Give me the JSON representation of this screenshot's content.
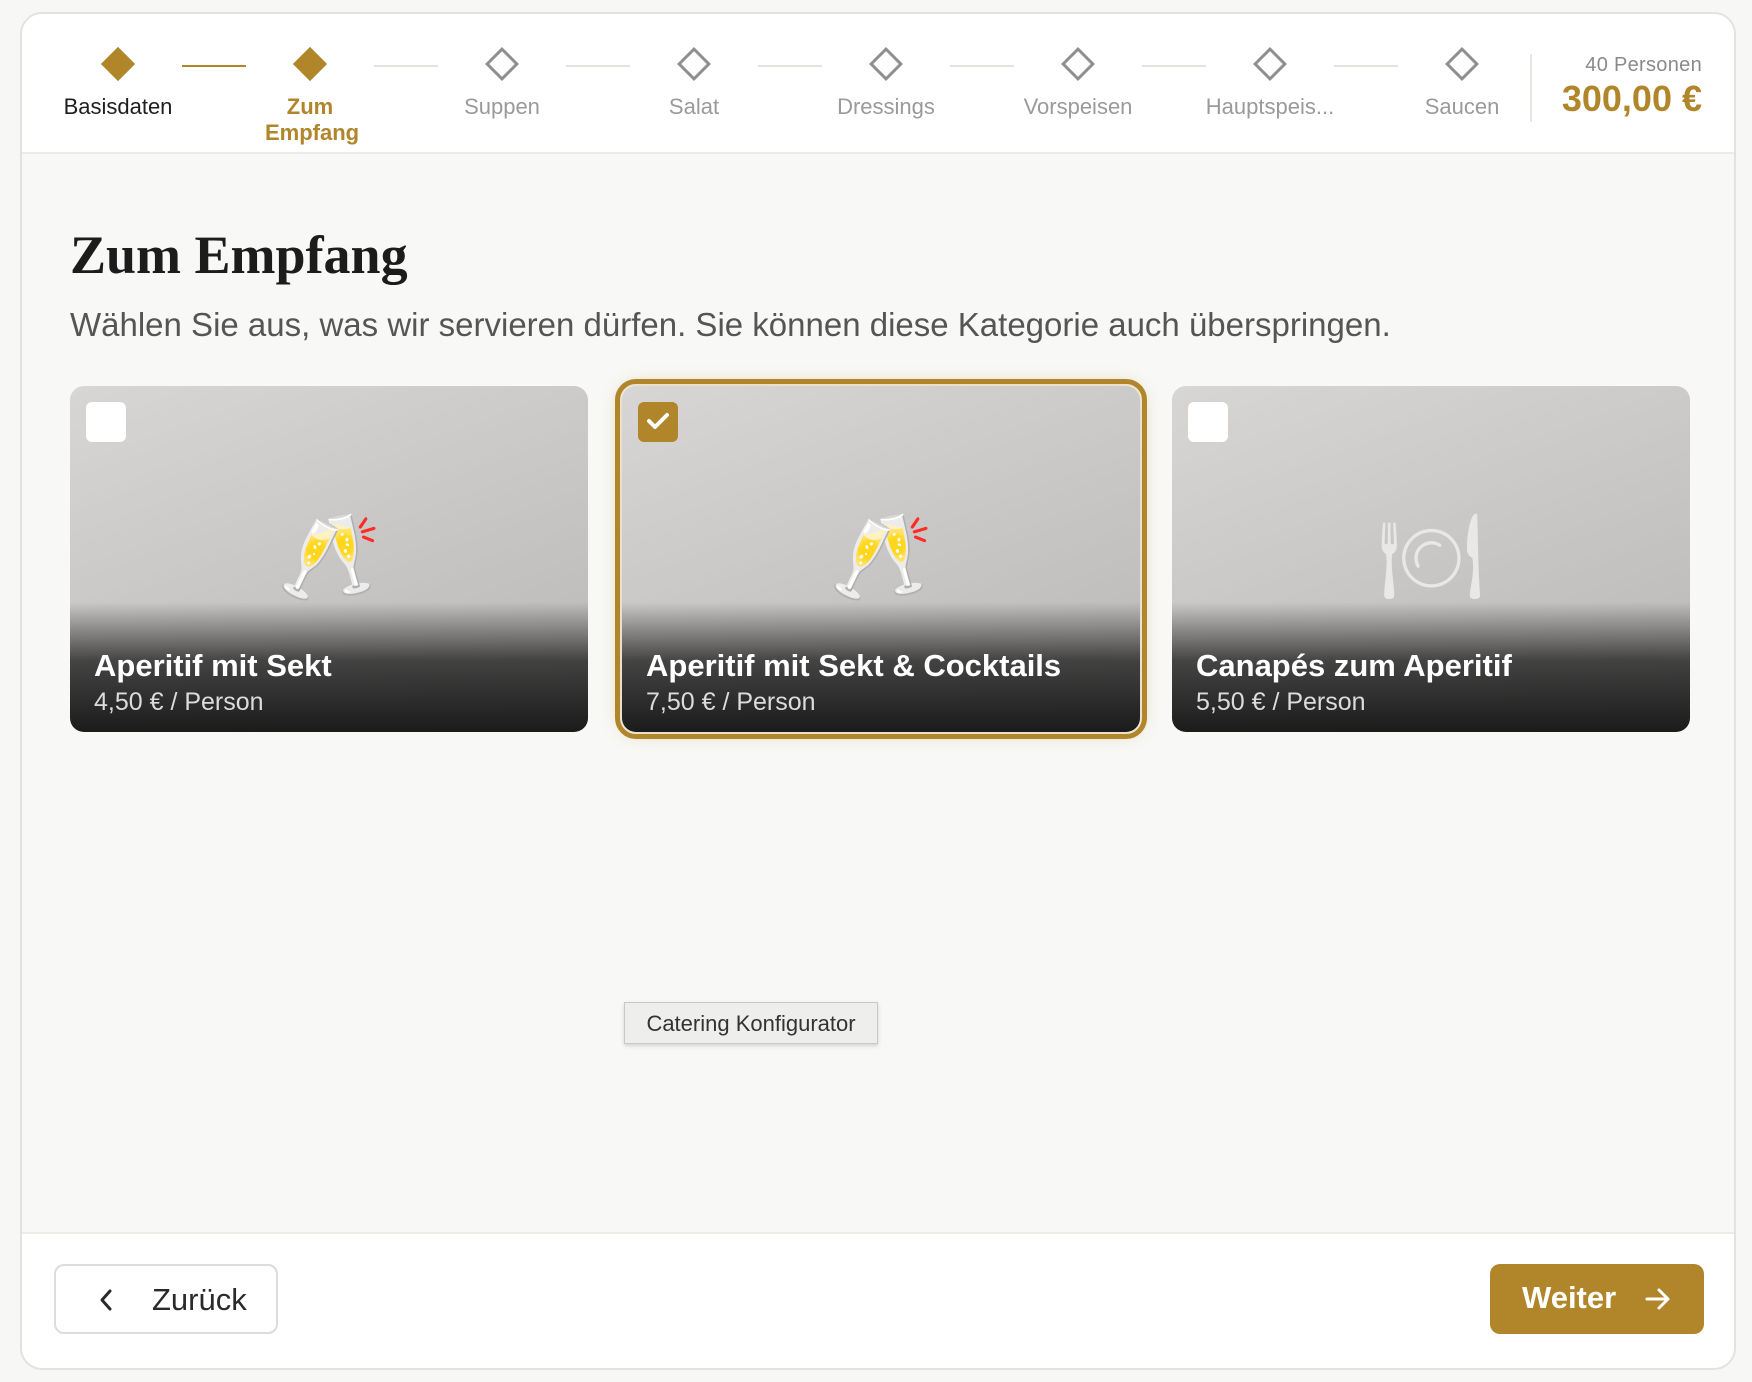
{
  "stepper": {
    "steps": [
      {
        "label": "Basisdaten",
        "state": "done"
      },
      {
        "label": "Zum Empfang",
        "state": "active"
      },
      {
        "label": "Suppen",
        "state": "pending"
      },
      {
        "label": "Salat",
        "state": "pending"
      },
      {
        "label": "Dressings",
        "state": "pending"
      },
      {
        "label": "Vorspeisen",
        "state": "pending"
      },
      {
        "label": "Hauptspeis...",
        "state": "pending"
      },
      {
        "label": "Saucen",
        "state": "pending"
      }
    ]
  },
  "summary": {
    "persons": "40 Personen",
    "total": "300,00 €"
  },
  "main": {
    "title": "Zum Empfang",
    "subtitle": "Wählen Sie aus, was wir servieren dürfen. Sie können diese Kategorie auch überspringen."
  },
  "options": [
    {
      "name": "Aperitif mit Sekt",
      "price": "4,50 € / Person",
      "selected": false,
      "icon": "champagne-glasses-icon"
    },
    {
      "name": "Aperitif mit Sekt & Cocktails",
      "price": "7,50 € / Person",
      "selected": true,
      "icon": "champagne-glasses-icon"
    },
    {
      "name": "Canapés zum Aperitif",
      "price": "5,50 € / Person",
      "selected": false,
      "icon": "plate-cutlery-icon"
    }
  ],
  "tooltip": "Catering Konfigurator",
  "footer": {
    "back_label": "Zurück",
    "next_label": "Weiter"
  },
  "colors": {
    "accent": "#b1862b",
    "pending": "#9a9a9a",
    "text": "#1c1c1c"
  }
}
